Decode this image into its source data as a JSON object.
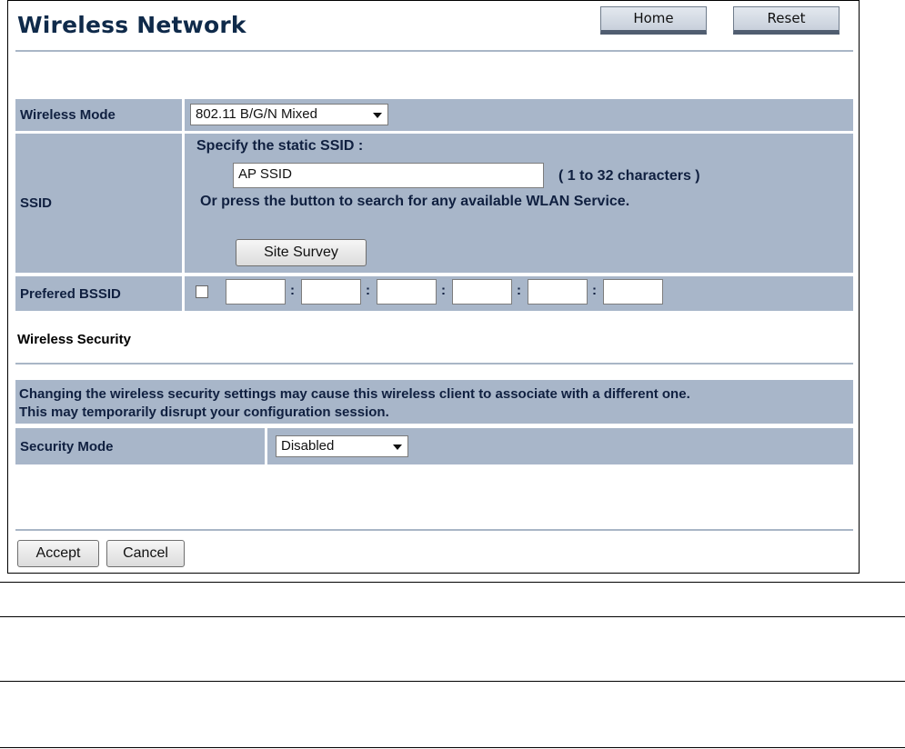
{
  "page": {
    "title": "Wireless Network",
    "home_label": "Home",
    "reset_label": "Reset"
  },
  "wireless": {
    "mode_label": "Wireless Mode",
    "mode_value": "802.11 B/G/N Mixed",
    "ssid_label": "SSID",
    "ssid_specify": "Specify the static SSID  :",
    "ssid_value": "AP SSID",
    "ssid_hint": "( 1 to 32 characters )",
    "ssid_search_text": "Or press the button to search for any available WLAN Service.",
    "site_survey_label": "Site Survey",
    "bssid_label": "Prefered BSSID",
    "bssid_colon": ":",
    "bssid_checked": false
  },
  "security": {
    "section_title": "Wireless Security",
    "warning_line1": "Changing the wireless security settings may cause this wireless client to associate with a different one.",
    "warning_line2": "This may temporarily disrupt your configuration session.",
    "mode_label": "Security Mode",
    "mode_value": "Disabled"
  },
  "footer": {
    "accept_label": "Accept",
    "cancel_label": "Cancel"
  }
}
